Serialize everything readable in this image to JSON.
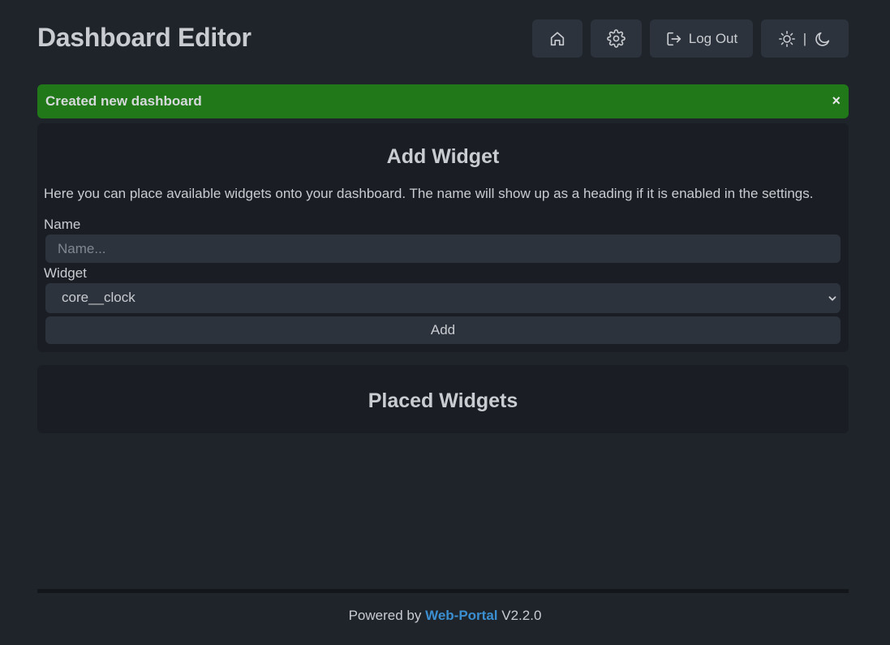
{
  "header": {
    "title": "Dashboard Editor",
    "home_icon": "home-icon",
    "settings_icon": "gear-icon",
    "logout_label": "Log Out",
    "logout_icon": "log-out-icon",
    "theme_separator": "|",
    "theme_icons": [
      "sun-icon",
      "moon-icon"
    ]
  },
  "alert": {
    "message": "Created new dashboard",
    "close": "×",
    "color": "#217818"
  },
  "add_widget": {
    "heading": "Add Widget",
    "description": "Here you can place available widgets onto your dashboard. The name will show up as a heading if it is enabled in the settings.",
    "name_label": "Name",
    "name_placeholder": "Name...",
    "name_value": "",
    "widget_label": "Widget",
    "widget_selected": "core__clock",
    "add_label": "Add"
  },
  "placed_widgets": {
    "heading": "Placed Widgets"
  },
  "footer": {
    "prefix": "Powered by",
    "link": "Web-Portal",
    "version": "V2.2.0",
    "link_color": "#3b8fd1"
  },
  "colors": {
    "background": "#1f242b",
    "card": "#1a1e24",
    "control": "#2c333c",
    "text": "#c9ccd1"
  }
}
